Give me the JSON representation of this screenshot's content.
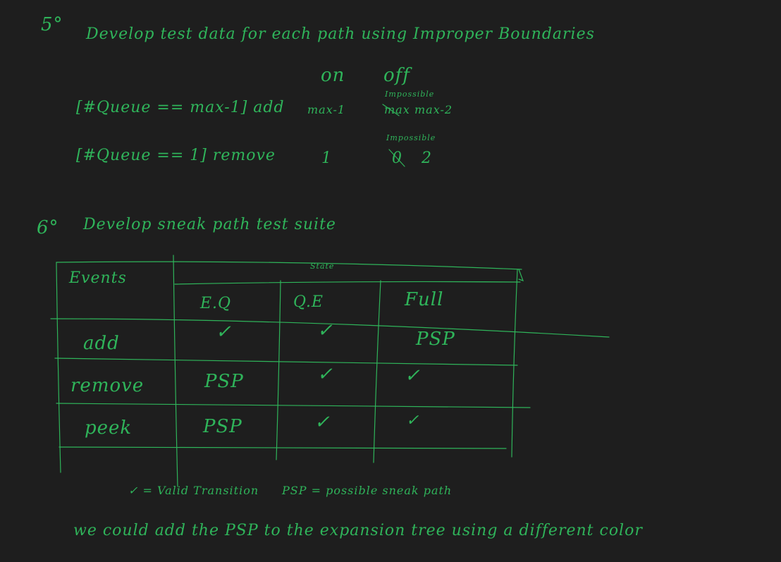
{
  "section5": {
    "number": "5°",
    "title": "Develop test data for each path using Improper Boundaries",
    "col_on": "on",
    "col_off": "off",
    "row1": {
      "guard": "[#Queue == max-1] add",
      "on": "max-1",
      "off_note": "Impossible",
      "off_struck": "max",
      "off": "max-2"
    },
    "row2": {
      "guard": "[#Queue == 1] remove",
      "on": "1",
      "off_note": "Impossible",
      "off_struck": "0",
      "off": "2"
    }
  },
  "section6": {
    "number": "6°",
    "title": "Develop sneak path test suite",
    "table": {
      "corner_header": "Events",
      "group_header": "State",
      "columns": [
        "E.Q",
        "Q.E",
        "Full"
      ],
      "rows": [
        {
          "event": "add",
          "cells": [
            "✓",
            "✓",
            "PSP"
          ]
        },
        {
          "event": "remove",
          "cells": [
            "PSP",
            "✓",
            "✓"
          ]
        },
        {
          "event": "peek",
          "cells": [
            "PSP",
            "✓",
            "✓"
          ]
        }
      ]
    },
    "legend": {
      "valid": "✓ = Valid Transition",
      "psp": "PSP = possible sneak path"
    },
    "note": "we could add the PSP to the expansion tree using a different color"
  }
}
